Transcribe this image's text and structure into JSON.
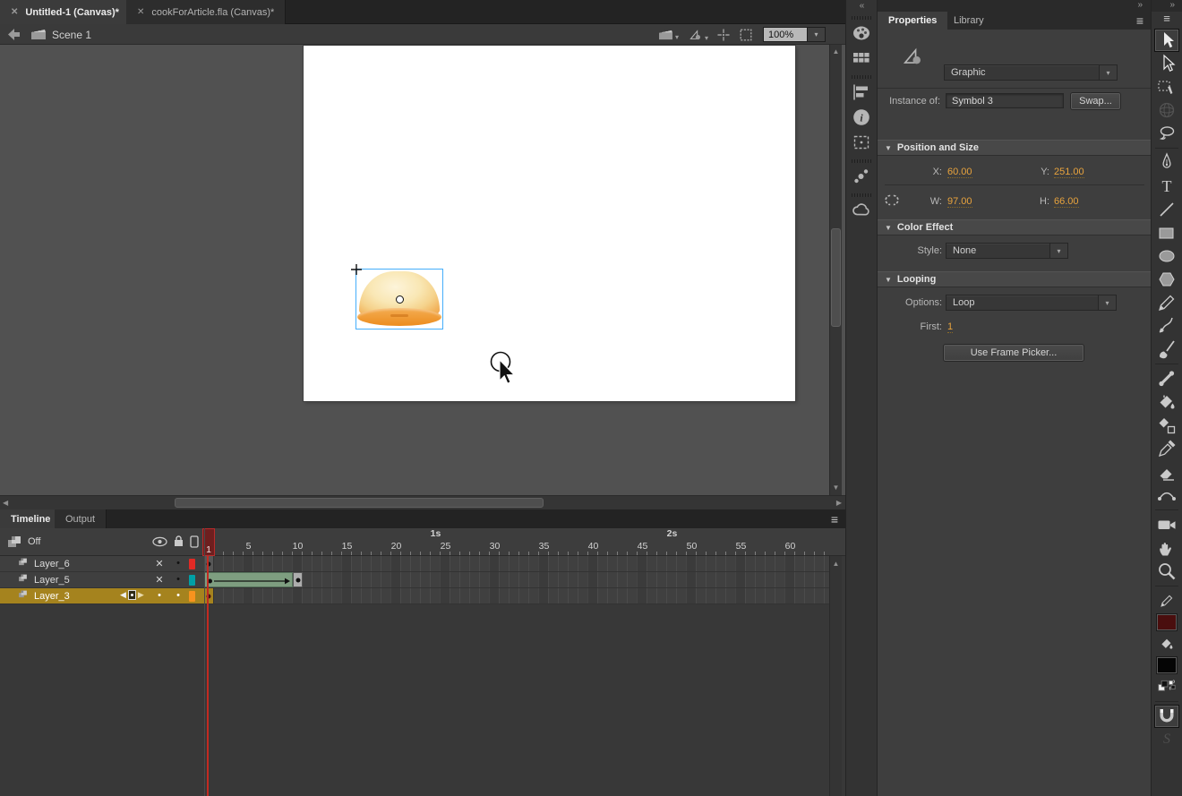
{
  "glyphs": {
    "close": "✕",
    "caret": "▾",
    "collapse_left": "«",
    "collapse_right": "»",
    "menu": "≡",
    "up": "▲",
    "down": "▼",
    "left": "◀",
    "right": "▶",
    "hidden_x": "✕",
    "dot": "•"
  },
  "document_tabs": [
    {
      "label": "Untitled-1 (Canvas)*",
      "active": true
    },
    {
      "label": "cookForArticle.fla (Canvas)*",
      "active": false
    }
  ],
  "edit_bar": {
    "scene": "Scene 1",
    "zoom": "100%"
  },
  "properties": {
    "tab_properties": "Properties",
    "tab_library": "Library",
    "symbol_type": "Graphic",
    "instance_label": "Instance of:",
    "instance_name": "Symbol 3",
    "swap_button": "Swap...",
    "sections": {
      "position": {
        "title": "Position and Size",
        "x_label": "X:",
        "x": "60.00",
        "y_label": "Y:",
        "y": "251.00",
        "w_label": "W:",
        "w": "97.00",
        "h_label": "H:",
        "h": "66.00"
      },
      "color": {
        "title": "Color Effect",
        "style_label": "Style:",
        "style_value": "None"
      },
      "looping": {
        "title": "Looping",
        "options_label": "Options:",
        "options_value": "Loop",
        "first_label": "First:",
        "first_value": "1",
        "frame_picker_button": "Use Frame Picker..."
      }
    }
  },
  "timeline": {
    "tab_timeline": "Timeline",
    "tab_output": "Output",
    "header_label": "Off",
    "playhead_frame": "1",
    "ruler": {
      "frame_width": 11,
      "numbers": [
        5,
        10,
        15,
        20,
        25,
        30,
        35,
        40,
        45,
        50,
        55,
        60
      ],
      "seconds": [
        {
          "label": "1s",
          "frame": 24
        },
        {
          "label": "2s",
          "frame": 48
        }
      ]
    },
    "layers": [
      {
        "name": "Layer_6",
        "hidden": true,
        "selected": false,
        "color": "#E12A25",
        "keyframe_at_1": true
      },
      {
        "name": "Layer_5",
        "hidden": true,
        "selected": false,
        "color": "#00A0A6",
        "keyframe_at_1": true,
        "tween": {
          "start": 1,
          "end": 10
        }
      },
      {
        "name": "Layer_3",
        "hidden": false,
        "selected": true,
        "color": "#F7931E",
        "keyframe_at_1": true
      }
    ]
  },
  "dock": {
    "groups": [
      [
        {
          "name": "color-panel",
          "label": "Color"
        },
        {
          "name": "swatches-panel",
          "label": "Swatches"
        }
      ],
      [
        {
          "name": "align-panel",
          "label": "Align"
        },
        {
          "name": "info-panel",
          "label": "Info"
        },
        {
          "name": "transform-panel",
          "label": "Transform"
        }
      ],
      [
        {
          "name": "motion-presets-panel",
          "label": "Motion Presets"
        }
      ],
      [
        {
          "name": "cc-libraries-panel",
          "label": "CC Libraries"
        }
      ]
    ]
  },
  "tools": {
    "sections": [
      {
        "items": [
          {
            "name": "selection-tool",
            "label": "Selection Tool",
            "active": true
          },
          {
            "name": "subselection-tool",
            "label": "Subselection Tool"
          },
          {
            "name": "free-transform-tool",
            "label": "Free Transform Tool"
          },
          {
            "name": "rotation-3d-tool",
            "label": "3D Rotation Tool",
            "disabled": true
          },
          {
            "name": "lasso-tool",
            "label": "Lasso Tool"
          }
        ]
      },
      {
        "items": [
          {
            "name": "pen-tool",
            "label": "Pen Tool"
          },
          {
            "name": "text-tool",
            "label": "Text Tool"
          },
          {
            "name": "line-tool",
            "label": "Line Tool"
          },
          {
            "name": "rectangle-tool",
            "label": "Rectangle Tool"
          },
          {
            "name": "oval-tool",
            "label": "Oval Tool"
          },
          {
            "name": "polystar-tool",
            "label": "PolyStar Tool"
          },
          {
            "name": "pencil-tool",
            "label": "Pencil Tool"
          },
          {
            "name": "paint-brush-tool",
            "label": "Paint Brush Tool"
          },
          {
            "name": "brush-tool",
            "label": "Brush Tool"
          }
        ]
      },
      {
        "items": [
          {
            "name": "bone-tool",
            "label": "Bone Tool"
          },
          {
            "name": "paint-bucket-tool",
            "label": "Paint Bucket Tool"
          },
          {
            "name": "ink-bottle-tool",
            "label": "Ink Bottle Tool"
          },
          {
            "name": "eyedropper-tool",
            "label": "Eyedropper Tool"
          },
          {
            "name": "eraser-tool",
            "label": "Eraser Tool"
          },
          {
            "name": "width-tool",
            "label": "Width Tool"
          }
        ]
      },
      {
        "items": [
          {
            "name": "camera-tool",
            "label": "Camera"
          },
          {
            "name": "hand-tool",
            "label": "Hand Tool"
          },
          {
            "name": "zoom-tool",
            "label": "Zoom Tool"
          }
        ]
      },
      {
        "items": [
          {
            "name": "stroke-color-control",
            "label": "Stroke Color",
            "swatch": "#4A0E0E"
          },
          {
            "name": "fill-color-control",
            "label": "Fill Color",
            "swatch": "#050505"
          },
          {
            "name": "color-defaults-swap",
            "label": "Black and White / Swap Colors"
          }
        ]
      },
      {
        "items": [
          {
            "name": "snap-to-objects-toggle",
            "label": "Snap to Objects",
            "active": true
          },
          {
            "name": "smooth-option",
            "label": "Smooth",
            "disabled": true
          }
        ]
      }
    ]
  },
  "colors": {
    "value_accent": "#E8A33D",
    "selection_outline": "#45AEFB",
    "playhead_red": "#C22A22",
    "selected_layer": "#A5831E",
    "tween_green": "#7E9E80",
    "stroke_swatch": "#4A0E0E",
    "fill_swatch": "#050505"
  }
}
